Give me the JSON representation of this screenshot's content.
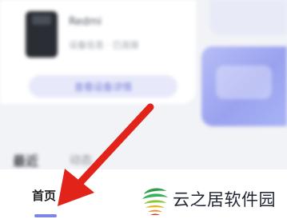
{
  "device_card": {
    "device_name": "Redmi",
    "device_subtitle": "设备信息 · 已连接",
    "action_button_label": "查看设备详情"
  },
  "section_tabs": {
    "recent_label": "最近",
    "activity_label": "动态"
  },
  "bottom_nav": {
    "home_label": "首页"
  },
  "watermark": {
    "text": "云之居软件园",
    "logo_icon": "yunzhiju-logo"
  },
  "overlay": {
    "arrow_color": "#e2231a",
    "arrow_icon": "pointer-arrow"
  },
  "colors": {
    "accent": "#7d86e6",
    "banner": "#9aa2ef"
  }
}
